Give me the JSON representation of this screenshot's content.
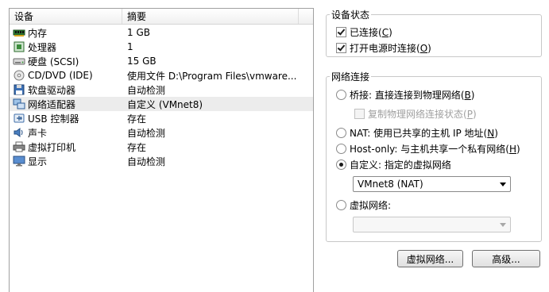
{
  "device_list": {
    "columns": {
      "device": "设备",
      "summary": "摘要"
    },
    "rows": [
      {
        "icon": "memory-icon",
        "name": "内存",
        "summary": "1 GB"
      },
      {
        "icon": "processor-icon",
        "name": "处理器",
        "summary": "1"
      },
      {
        "icon": "hard-disk-icon",
        "name": "硬盘 (SCSI)",
        "summary": "15 GB"
      },
      {
        "icon": "cd-dvd-icon",
        "name": "CD/DVD (IDE)",
        "summary": "使用文件 D:\\Program Files\\vmware..."
      },
      {
        "icon": "floppy-icon",
        "name": "软盘驱动器",
        "summary": "自动检测"
      },
      {
        "icon": "network-adapter-icon",
        "name": "网络适配器",
        "summary": "自定义 (VMnet8)"
      },
      {
        "icon": "usb-icon",
        "name": "USB 控制器",
        "summary": "存在"
      },
      {
        "icon": "sound-card-icon",
        "name": "声卡",
        "summary": "自动检测"
      },
      {
        "icon": "printer-icon",
        "name": "虚拟打印机",
        "summary": "存在"
      },
      {
        "icon": "display-icon",
        "name": "显示",
        "summary": "自动检测"
      }
    ],
    "selected_index": 5
  },
  "device_status": {
    "title": "设备状态",
    "connected": {
      "label": "已连接(",
      "key": "C",
      "suffix": ")",
      "checked": true
    },
    "connect_at_power_on": {
      "label": "打开电源时连接(",
      "key": "O",
      "suffix": ")",
      "checked": true
    }
  },
  "network_connection": {
    "title": "网络连接",
    "bridged": {
      "label": "桥接: 直接连接到物理网络(",
      "key": "B",
      "suffix": ")",
      "selected": false
    },
    "replicate_state": {
      "label": "复制物理网络连接状态(",
      "key": "P",
      "suffix": ")",
      "checked": false,
      "enabled": false
    },
    "nat": {
      "label": "NAT: 使用已共享的主机 IP 地址(",
      "key": "N",
      "suffix": ")",
      "selected": false
    },
    "host_only": {
      "label": "Host-only: 与主机共享一个私有网络(",
      "key": "H",
      "suffix": ")",
      "selected": false
    },
    "custom": {
      "label": "自定义: 指定的虚拟网络",
      "selected": true
    },
    "custom_select_value": "VMnet8 (NAT)",
    "lan_segment": {
      "label": "虚拟网络:",
      "selected": false
    },
    "lan_segment_select_value": ""
  },
  "buttons": {
    "virtual_network": "虚拟网络...",
    "advanced": "高级..."
  }
}
